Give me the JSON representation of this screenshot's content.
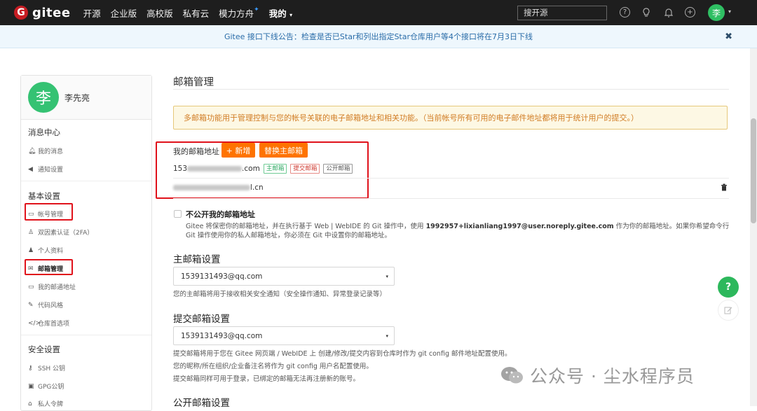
{
  "nav": {
    "logo_text": "gitee",
    "logo_mark": "G",
    "items": [
      "开源",
      "企业版",
      "高校版",
      "私有云",
      "模力方舟",
      "我的"
    ],
    "star": "✦",
    "mine_caret": "▾",
    "search_placeholder": "搜开源",
    "icons": [
      "help-icon",
      "bulb-icon",
      "bell-icon",
      "plus-icon"
    ],
    "avatar_text": "李"
  },
  "announcement": {
    "text": "Gitee 接口下线公告：检查是否已Star和列出指定Star仓库用户等4个接口将在7月3日下线",
    "close": "✖"
  },
  "sidebar": {
    "user_name": "李先亮",
    "avatar_text": "李",
    "sections": {
      "messages": "消息中心",
      "basic": "基本设置",
      "security": "安全设置"
    },
    "items": {
      "my_messages": "我的消息",
      "notify_settings": "通知设置",
      "account": "帐号管理",
      "two_fa": "双因素认证（2FA）",
      "profile": "个人资料",
      "email_mgmt": "邮箱管理",
      "my_notify_addr": "我的邮通地址",
      "code_style": "代码风格",
      "repo_prefs": "仓库首选项",
      "ssh": "SSH 公钥",
      "gpg": "GPG公钥",
      "token": "私人令牌"
    }
  },
  "main": {
    "title": "邮箱管理",
    "warning": "多邮箱功能用于管理控制与您的帐号关联的电子邮箱地址和相关功能。（当前帐号所有可用的电子邮件地址都将用于统计用户的提交。）",
    "emails_label": "我的邮箱地址",
    "add_button": "+ 新增",
    "replace_button": "替换主邮箱",
    "email1_prefix": "153",
    "email1_suffix": ".com",
    "tags": [
      "主邮箱",
      "提交邮箱",
      "公开邮箱"
    ],
    "email2_suffix": "l.cn",
    "hide_email_label": "不公开我的邮箱地址",
    "hide_email_desc_1": "Gitee 将保密你的邮箱地址，并在执行基于 Web | WebIDE 的 Git 操作中，使用",
    "hide_email_desc_bold": "1992957+lixianliang1997@user.noreply.gitee.com",
    "hide_email_desc_2": "作为你的邮箱地址。如果你希望命令行 Git 操作使用你的私人邮箱地址，你必须在 Git 中设置你的邮箱地址。",
    "primary_title": "主邮箱设置",
    "primary_value": "1539131493@qq.com",
    "primary_hint": "您的主邮箱将用于接收相关安全通知（安全操作通知、异常登录记录等）",
    "commit_title": "提交邮箱设置",
    "commit_value": "1539131493@qq.com",
    "commit_hints": [
      "提交邮箱将用于您在 Gitee 网页端 / WebIDE 上 创建/修改/提交内容到仓库时作为 git config 邮件地址配置使用。",
      "您的昵称/所在组织/企业备注名将作为 git config 用户名配置使用。",
      "提交邮箱同样可用于登录，已绑定的邮箱无法再注册新的账号。"
    ],
    "public_title": "公开邮箱设置",
    "select_caret": "▾"
  },
  "floating": {
    "help": "?"
  },
  "watermark": {
    "text": "公众号 · 尘水程序员"
  },
  "colors": {
    "brand_red": "#c71d23",
    "accent_orange": "#fe7300",
    "help_green": "#2db85c",
    "annotation_red": "#e0121b"
  }
}
